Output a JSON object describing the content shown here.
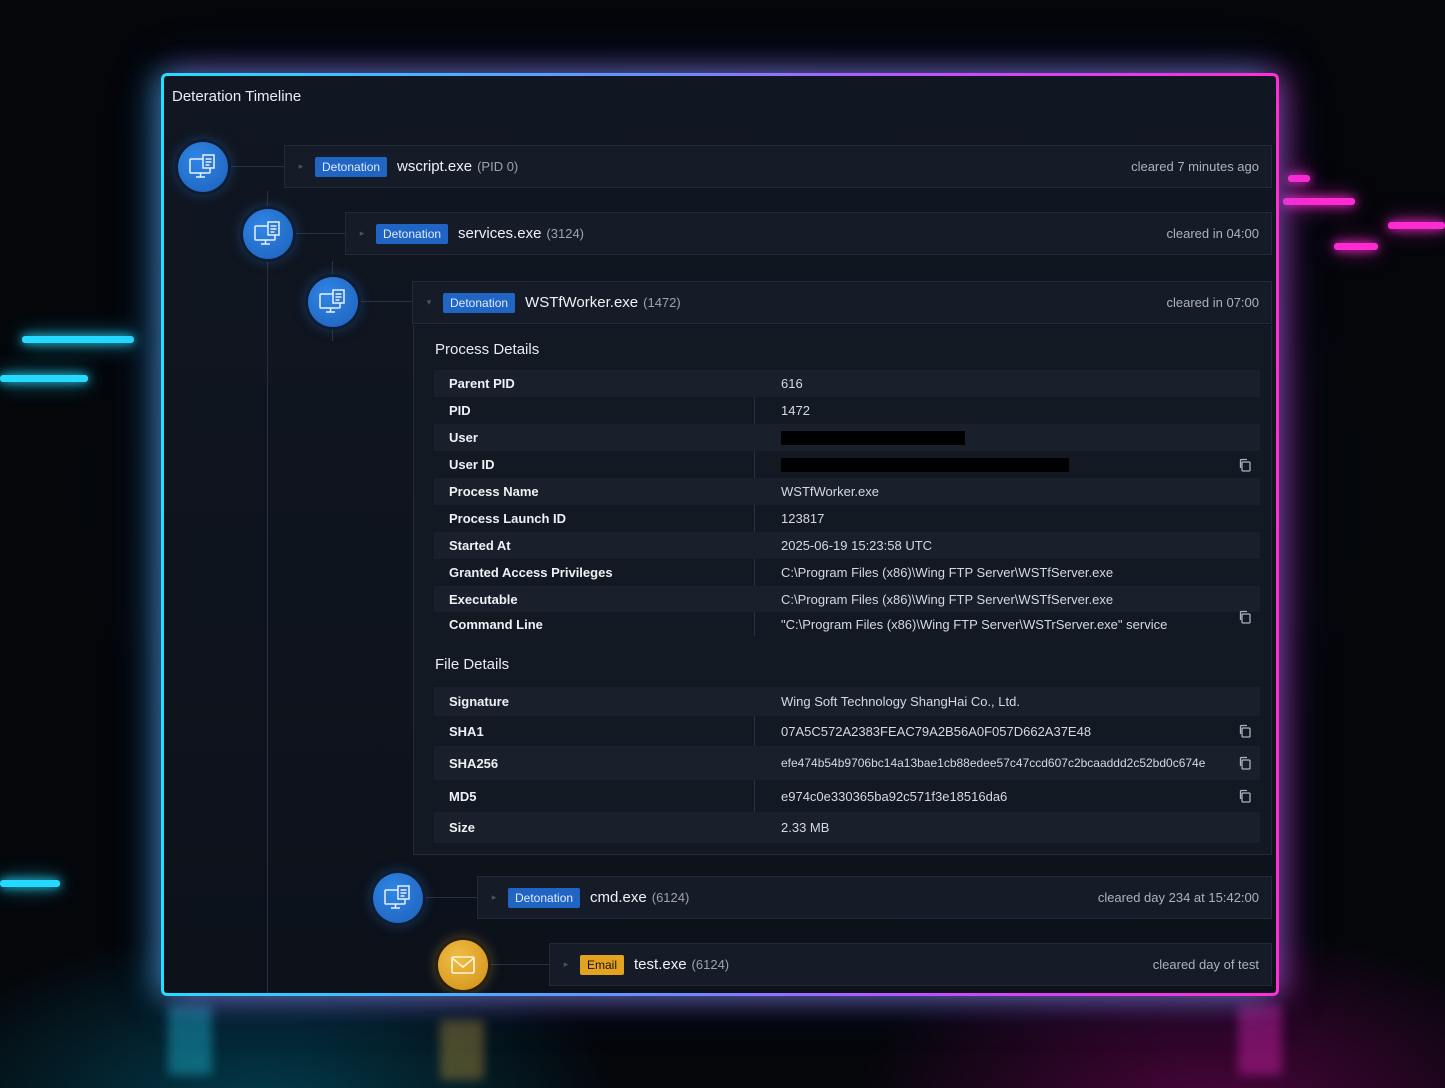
{
  "panel": {
    "title": "Deteration Timeline"
  },
  "timeline": [
    {
      "badge": "Detonation",
      "badge_type": "detonation",
      "process": "wscript.exe",
      "pid": "(PID 0)",
      "when": "cleared 7 minutes ago",
      "icon": "monitor-document-icon"
    },
    {
      "badge": "Detonation",
      "badge_type": "detonation",
      "process": "services.exe",
      "pid": "(3124)",
      "when": "cleared in 04:00",
      "icon": "monitor-document-icon"
    },
    {
      "badge": "Detonation",
      "badge_type": "detonation",
      "process": "WSTfWorker.exe",
      "pid": "(1472)",
      "when": "cleared in 07:00",
      "icon": "monitor-document-icon"
    },
    {
      "badge": "Detonation",
      "badge_type": "detonation",
      "process": "cmd.exe",
      "pid": "(6124)",
      "when": "cleared day 234 at 15:42:00",
      "icon": "monitor-document-icon"
    },
    {
      "badge": "Email",
      "badge_type": "email",
      "process": "test.exe",
      "pid": "(6124)",
      "when": "cleared day of test",
      "icon": "envelope-icon"
    }
  ],
  "process_details": {
    "title": "Process Details",
    "rows": [
      {
        "key": "Parent PID",
        "value": "616"
      },
      {
        "key": "PID",
        "value": "1472"
      },
      {
        "key": "User",
        "value": ""
      },
      {
        "key": "User ID",
        "value": ""
      },
      {
        "key": "Process Name",
        "value": "WSTfWorker.exe"
      },
      {
        "key": "Process Launch ID",
        "value": "123817"
      },
      {
        "key": "Started At",
        "value": "2025-06-19 15:23:58 UTC"
      },
      {
        "key": "Granted Access Privileges",
        "value": "C:\\Program Files (x86)\\Wing FTP Server\\WSTfServer.exe"
      },
      {
        "key": "Executable",
        "value": "C:\\Program Files (x86)\\Wing FTP Server\\WSTfServer.exe"
      },
      {
        "key": "Command Line",
        "value": "\"C:\\Program Files (x86)\\Wing FTP Server\\WSTrServer.exe\" service"
      }
    ]
  },
  "file_details": {
    "title": "File Details",
    "rows": [
      {
        "key": "Signature",
        "value": "Wing Soft Technology ShangHai Co., Ltd."
      },
      {
        "key": "SHA1",
        "value": "07A5C572A2383FEAC79A2B56A0F057D662A37E48"
      },
      {
        "key": "SHA256",
        "value": "efe474b54b9706bc14a13bae1cb88edee57c47ccd607c2bcaaddd2c52bd0c674e"
      },
      {
        "key": "MD5",
        "value": "e974c0e330365ba92c571f3e18516da6"
      },
      {
        "key": "Size",
        "value": "2.33 MB"
      }
    ]
  },
  "colors": {
    "accent_blue": "#2064c4",
    "email_gold": "#e3a321",
    "neon_cyan": "#25d9ff",
    "neon_magenta": "#ff2bd2"
  }
}
